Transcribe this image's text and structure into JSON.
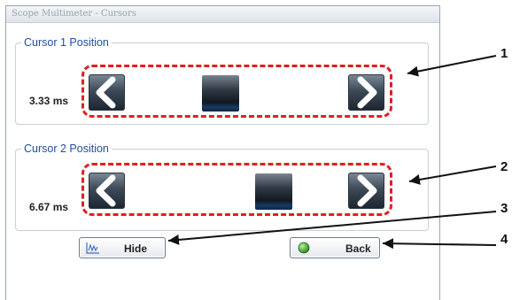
{
  "window": {
    "title": "Scope Multimeter - Cursors"
  },
  "cursor1": {
    "legend": "Cursor 1 Position",
    "value": "3.33 ms",
    "left_icon": "chevron-left-icon",
    "right_icon": "chevron-right-icon"
  },
  "cursor2": {
    "legend": "Cursor 2 Position",
    "value": "6.67 ms",
    "left_icon": "chevron-left-icon",
    "right_icon": "chevron-right-icon"
  },
  "buttons": {
    "hide": {
      "label": "Hide",
      "icon": "waveform-icon"
    },
    "back": {
      "label": "Back",
      "icon": "green-dot-icon"
    }
  },
  "callouts": [
    "1",
    "2",
    "3",
    "4"
  ],
  "colors": {
    "highlight": "#e02020",
    "legend_text": "#1e4f9c",
    "thumb_accent": "#163b63",
    "back_icon": "#3c9a2f"
  }
}
